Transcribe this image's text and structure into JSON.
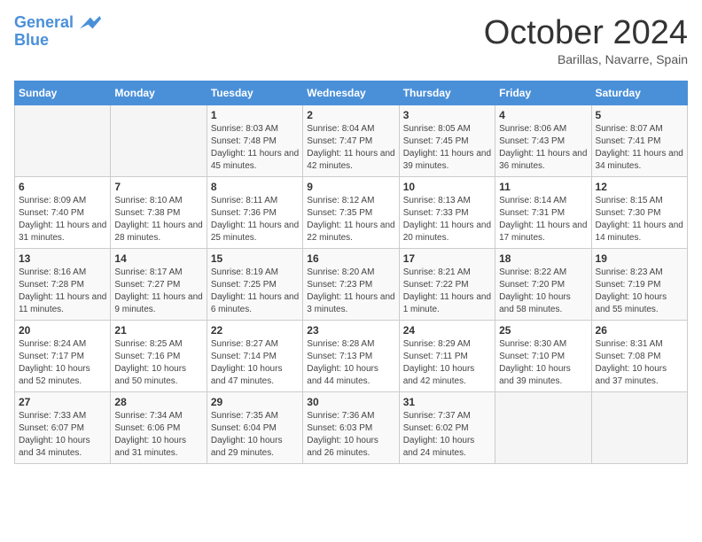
{
  "header": {
    "logo_line1": "General",
    "logo_line2": "Blue",
    "month_title": "October 2024",
    "subtitle": "Barillas, Navarre, Spain"
  },
  "days_of_week": [
    "Sunday",
    "Monday",
    "Tuesday",
    "Wednesday",
    "Thursday",
    "Friday",
    "Saturday"
  ],
  "weeks": [
    [
      {
        "day": "",
        "info": ""
      },
      {
        "day": "",
        "info": ""
      },
      {
        "day": "1",
        "info": "Sunrise: 8:03 AM\nSunset: 7:48 PM\nDaylight: 11 hours and 45 minutes."
      },
      {
        "day": "2",
        "info": "Sunrise: 8:04 AM\nSunset: 7:47 PM\nDaylight: 11 hours and 42 minutes."
      },
      {
        "day": "3",
        "info": "Sunrise: 8:05 AM\nSunset: 7:45 PM\nDaylight: 11 hours and 39 minutes."
      },
      {
        "day": "4",
        "info": "Sunrise: 8:06 AM\nSunset: 7:43 PM\nDaylight: 11 hours and 36 minutes."
      },
      {
        "day": "5",
        "info": "Sunrise: 8:07 AM\nSunset: 7:41 PM\nDaylight: 11 hours and 34 minutes."
      }
    ],
    [
      {
        "day": "6",
        "info": "Sunrise: 8:09 AM\nSunset: 7:40 PM\nDaylight: 11 hours and 31 minutes."
      },
      {
        "day": "7",
        "info": "Sunrise: 8:10 AM\nSunset: 7:38 PM\nDaylight: 11 hours and 28 minutes."
      },
      {
        "day": "8",
        "info": "Sunrise: 8:11 AM\nSunset: 7:36 PM\nDaylight: 11 hours and 25 minutes."
      },
      {
        "day": "9",
        "info": "Sunrise: 8:12 AM\nSunset: 7:35 PM\nDaylight: 11 hours and 22 minutes."
      },
      {
        "day": "10",
        "info": "Sunrise: 8:13 AM\nSunset: 7:33 PM\nDaylight: 11 hours and 20 minutes."
      },
      {
        "day": "11",
        "info": "Sunrise: 8:14 AM\nSunset: 7:31 PM\nDaylight: 11 hours and 17 minutes."
      },
      {
        "day": "12",
        "info": "Sunrise: 8:15 AM\nSunset: 7:30 PM\nDaylight: 11 hours and 14 minutes."
      }
    ],
    [
      {
        "day": "13",
        "info": "Sunrise: 8:16 AM\nSunset: 7:28 PM\nDaylight: 11 hours and 11 minutes."
      },
      {
        "day": "14",
        "info": "Sunrise: 8:17 AM\nSunset: 7:27 PM\nDaylight: 11 hours and 9 minutes."
      },
      {
        "day": "15",
        "info": "Sunrise: 8:19 AM\nSunset: 7:25 PM\nDaylight: 11 hours and 6 minutes."
      },
      {
        "day": "16",
        "info": "Sunrise: 8:20 AM\nSunset: 7:23 PM\nDaylight: 11 hours and 3 minutes."
      },
      {
        "day": "17",
        "info": "Sunrise: 8:21 AM\nSunset: 7:22 PM\nDaylight: 11 hours and 1 minute."
      },
      {
        "day": "18",
        "info": "Sunrise: 8:22 AM\nSunset: 7:20 PM\nDaylight: 10 hours and 58 minutes."
      },
      {
        "day": "19",
        "info": "Sunrise: 8:23 AM\nSunset: 7:19 PM\nDaylight: 10 hours and 55 minutes."
      }
    ],
    [
      {
        "day": "20",
        "info": "Sunrise: 8:24 AM\nSunset: 7:17 PM\nDaylight: 10 hours and 52 minutes."
      },
      {
        "day": "21",
        "info": "Sunrise: 8:25 AM\nSunset: 7:16 PM\nDaylight: 10 hours and 50 minutes."
      },
      {
        "day": "22",
        "info": "Sunrise: 8:27 AM\nSunset: 7:14 PM\nDaylight: 10 hours and 47 minutes."
      },
      {
        "day": "23",
        "info": "Sunrise: 8:28 AM\nSunset: 7:13 PM\nDaylight: 10 hours and 44 minutes."
      },
      {
        "day": "24",
        "info": "Sunrise: 8:29 AM\nSunset: 7:11 PM\nDaylight: 10 hours and 42 minutes."
      },
      {
        "day": "25",
        "info": "Sunrise: 8:30 AM\nSunset: 7:10 PM\nDaylight: 10 hours and 39 minutes."
      },
      {
        "day": "26",
        "info": "Sunrise: 8:31 AM\nSunset: 7:08 PM\nDaylight: 10 hours and 37 minutes."
      }
    ],
    [
      {
        "day": "27",
        "info": "Sunrise: 7:33 AM\nSunset: 6:07 PM\nDaylight: 10 hours and 34 minutes."
      },
      {
        "day": "28",
        "info": "Sunrise: 7:34 AM\nSunset: 6:06 PM\nDaylight: 10 hours and 31 minutes."
      },
      {
        "day": "29",
        "info": "Sunrise: 7:35 AM\nSunset: 6:04 PM\nDaylight: 10 hours and 29 minutes."
      },
      {
        "day": "30",
        "info": "Sunrise: 7:36 AM\nSunset: 6:03 PM\nDaylight: 10 hours and 26 minutes."
      },
      {
        "day": "31",
        "info": "Sunrise: 7:37 AM\nSunset: 6:02 PM\nDaylight: 10 hours and 24 minutes."
      },
      {
        "day": "",
        "info": ""
      },
      {
        "day": "",
        "info": ""
      }
    ]
  ]
}
